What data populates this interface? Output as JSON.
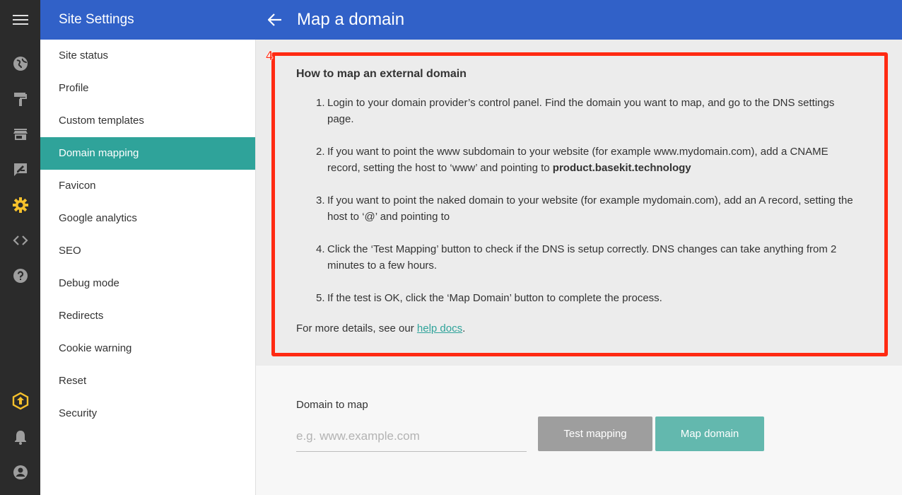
{
  "header": {
    "site_title": "Site Settings",
    "page_title": "Map a domain"
  },
  "rail": {
    "icons": [
      "menu-icon",
      "globe-icon",
      "paint-roller-icon",
      "store-icon",
      "edit-icon",
      "settings-icon",
      "code-icon",
      "help-icon",
      "upgrade-icon",
      "bell-icon",
      "account-icon"
    ],
    "active": "settings-icon",
    "colors": {
      "default": "#9e9e9e",
      "active": "#f6c12c",
      "upgrade": "#f6c12c"
    }
  },
  "sidebar": {
    "items": [
      {
        "label": "Site status"
      },
      {
        "label": "Profile"
      },
      {
        "label": "Custom templates"
      },
      {
        "label": "Domain mapping"
      },
      {
        "label": "Favicon"
      },
      {
        "label": "Google analytics"
      },
      {
        "label": "SEO"
      },
      {
        "label": "Debug mode"
      },
      {
        "label": "Redirects"
      },
      {
        "label": "Cookie warning"
      },
      {
        "label": "Reset"
      },
      {
        "label": "Security"
      }
    ],
    "active_index": 3
  },
  "info": {
    "badge": "4",
    "heading": "How to map an external domain",
    "steps": [
      {
        "num": "1.",
        "text": "Login to your domain provider’s control panel. Find the domain you want to map, and go to the DNS settings page."
      },
      {
        "num": "2.",
        "text": "If you want to point the www subdomain to your website (for example www.mydomain.com), add a CNAME record, setting the host to ‘www’ and pointing to ",
        "bold": "product.basekit.technology"
      },
      {
        "num": "3.",
        "text": "If you want to point the naked domain to your website (for example mydomain.com), add an A record, setting the host to ‘@’ and pointing to"
      },
      {
        "num": "4.",
        "text": "Click the ‘Test Mapping’ button to check if the DNS is setup correctly. DNS changes can take anything from 2 minutes to a few hours."
      },
      {
        "num": "5.",
        "text": "If the test is OK, click the ‘Map Domain’ button to complete the process."
      }
    ],
    "more_prefix": "For more details, see our ",
    "more_link": "help docs",
    "more_suffix": "."
  },
  "form": {
    "label": "Domain to map",
    "placeholder": "e.g. www.example.com",
    "value": "",
    "test_button": "Test mapping",
    "map_button": "Map domain"
  },
  "colors": {
    "header": "#3161c8",
    "active_nav": "#2fa39a",
    "highlight": "#ff2a12",
    "map_button": "#63b8ae",
    "test_button": "#9e9e9e"
  }
}
